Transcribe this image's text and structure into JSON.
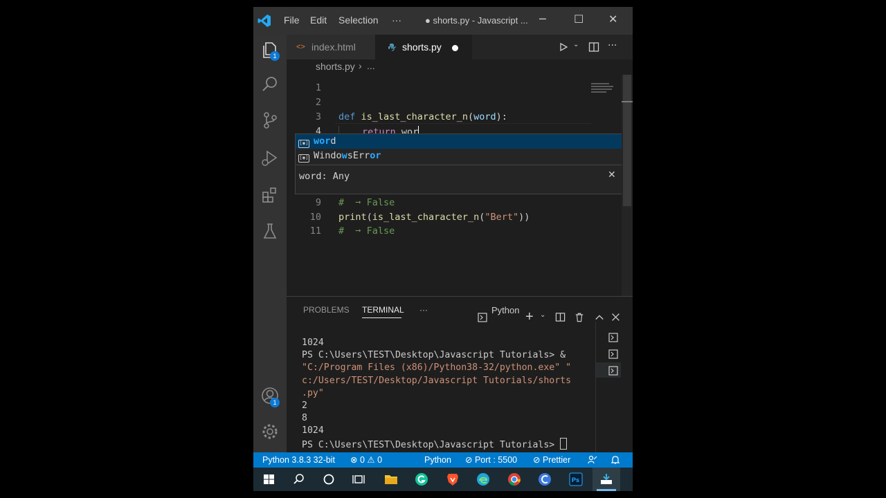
{
  "titlebar": {
    "menu": [
      "File",
      "Edit",
      "Selection",
      "···"
    ],
    "title": "● shorts.py - Javascript ...",
    "controls": [
      "─",
      "☐",
      "✕"
    ]
  },
  "activity": {
    "explorer_badge": "1",
    "account_badge": "1"
  },
  "tabs": [
    {
      "label": "index.html",
      "icon": "<>",
      "active": false
    },
    {
      "label": "shorts.py",
      "active": true,
      "modified": true
    }
  ],
  "breadcrumb": {
    "file": "shorts.py",
    "sep": "›",
    "rest": "..."
  },
  "editor": {
    "line_numbers": [
      "1",
      "2",
      "3",
      "4",
      "9",
      "10",
      "11"
    ],
    "line3": {
      "kw": "def",
      "name": "is_last_character_n",
      "open": "(",
      "param": "word",
      "close": "):"
    },
    "line4": {
      "kw": "return",
      "text": " wor"
    },
    "line9": "#  ➞ False",
    "line10": {
      "fn": "print",
      "a": "(",
      "call": "is_last_character_n",
      "b": "(",
      "str": "\"Bert\"",
      "c": "))"
    },
    "line11": "#  ➞ False"
  },
  "suggest": {
    "items": [
      {
        "match": "wor",
        "rest": "d"
      },
      {
        "pre": "Windo",
        "m1": "w",
        "mid": "sErr",
        "m2": "or",
        "post": ""
      }
    ],
    "detail": "word: Any",
    "close": "✕"
  },
  "panel": {
    "tabs": [
      "PROBLEMS",
      "TERMINAL",
      "···"
    ],
    "shell": "Python",
    "plus": "+",
    "terminal_lines": [
      "1024",
      "PS C:\\Users\\TEST\\Desktop\\Javascript Tutorials> &",
      "\"C:/Program Files (x86)/Python38-32/python.exe\" \"",
      "c:/Users/TEST/Desktop/Javascript Tutorials/shorts",
      ".py\"",
      "2",
      "8",
      "1024",
      "PS C:\\Users\\TEST\\Desktop\\Javascript Tutorials> "
    ]
  },
  "status": {
    "interpreter": "Python 3.8.3 32-bit",
    "errors": "0",
    "warnings": "0",
    "language": "Python",
    "port": "Port : 5500",
    "prettier": "Prettier"
  },
  "colors": {
    "accent": "#007acc",
    "sidebar": "#333333",
    "editor_bg": "#1e1e1e"
  }
}
